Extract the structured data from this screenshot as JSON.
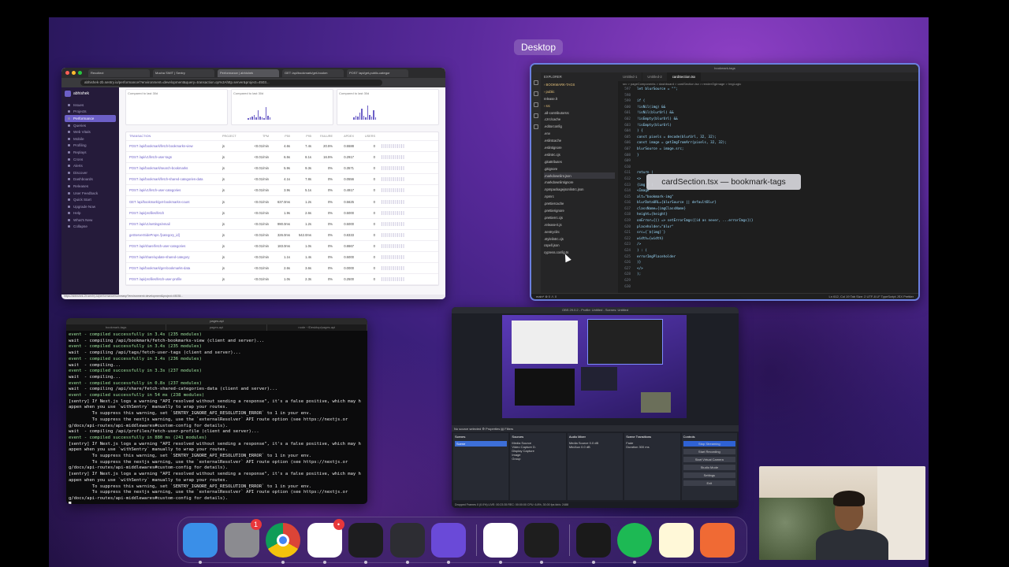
{
  "mission_control": {
    "space_label": "Desktop",
    "add_space": "+"
  },
  "browser": {
    "tabs": [
      "Recollect",
      "Mocha SWIT | Sentry",
      "Performance | abhishek",
      "GET /api/bookmark/get-bookm",
      "POST /api/get-public-categor"
    ],
    "url": "abhishek-2b.sentry.io/performance/?environment=development&query=transaction.op%3Ahttp.server&project=4503...",
    "org": "abhishek",
    "nav": [
      "Issues",
      "Projects",
      "Performance",
      "Queries",
      "Web Vitals",
      "Mobile",
      "Profiling",
      "Replays",
      "Crons",
      "Alerts",
      "Discover",
      "Dashboards",
      "Releases",
      "User Feedback",
      "Quick Start",
      "Upgrade Now",
      "Help",
      "What's New",
      "Collapse"
    ],
    "cards": [
      "Compared to last 30d",
      "Compared to last 30d",
      "Compared to last 30d"
    ],
    "table_header": [
      "TRANSACTION",
      "PROJECT",
      "TPM",
      "P50",
      "P95",
      "FAILURE",
      "APDEX",
      "USERS"
    ],
    "rows": [
      [
        "POST /api/bookmark/fetch-bookmarks-view",
        "js",
        "<0.01/min",
        "4.6s",
        "7.4s",
        "20.5%",
        "0.5588",
        "0"
      ],
      [
        "POST /api/v1/fetch-user-tags",
        "js",
        "<0.01/min",
        "6.5s",
        "8.1s",
        "16.5%",
        "0.2917",
        "0"
      ],
      [
        "POST /api/bookmark/search-bookmarks",
        "js",
        "<0.01/min",
        "5.9s",
        "9.3s",
        "0%",
        "0.3571",
        "0"
      ],
      [
        "POST /api/bookmark/fetch-shared-categories-data",
        "js",
        "<0.01/min",
        "4.1s",
        "7.8s",
        "0%",
        "0.0556",
        "0"
      ],
      [
        "POST /api/v1/fetch-user-categories",
        "js",
        "<0.01/min",
        "3.9s",
        "5.1s",
        "0%",
        "0.4917",
        "0"
      ],
      [
        "GET /api/bookmark/get-bookmarks-count",
        "js",
        "<0.01/min",
        "637.0ms",
        "1.2s",
        "0%",
        "0.5625",
        "0"
      ],
      [
        "POST /api/profiles/fetch",
        "js",
        "<0.01/min",
        "1.9s",
        "2.6s",
        "0%",
        "0.5000",
        "0"
      ],
      [
        "POST /api/v1/settings/email",
        "js",
        "<0.01/min",
        "990.0ms",
        "1.2s",
        "0%",
        "0.5000",
        "0"
      ],
      [
        "getServerSideProps /[category_id]",
        "js",
        "<0.01/min",
        "326.0ms",
        "542.0ms",
        "0%",
        "0.8333",
        "0"
      ],
      [
        "POST /api/share/fetch-user-categories",
        "js",
        "<0.01/min",
        "183.0ms",
        "1.0s",
        "0%",
        "0.8667",
        "0"
      ],
      [
        "POST /api/share/update-shared-category",
        "js",
        "<0.01/min",
        "1.1s",
        "1.4s",
        "0%",
        "0.5000",
        "0"
      ],
      [
        "POST /api/bookmark/get-bookmarks-data",
        "js",
        "<0.01/min",
        "2.6s",
        "3.6s",
        "0%",
        "0.0000",
        "0"
      ],
      [
        "POST /api/profiles/fetch-user-profile",
        "js",
        "<0.01/min",
        "1.0s",
        "2.3s",
        "0%",
        "0.2500",
        "0"
      ]
    ],
    "status": "https://abhishek-2b.sentry.io/performance/summary/?environment=development&project=45035..."
  },
  "vscode": {
    "title": "bookmark-tags",
    "explorer_header": "EXPLORER",
    "files": [
      {
        "name": "BOOKMARK-TAGS",
        "type": "folder"
      },
      {
        "name": "public",
        "type": "folder"
      },
      {
        "name": "release.lt",
        "type": "file"
      },
      {
        "name": "src",
        "type": "folder"
      },
      {
        "name": ".all-contributorsrc",
        "type": "file"
      },
      {
        "name": ".czrc/cache",
        "type": "file"
      },
      {
        "name": ".editorconfig",
        "type": "file"
      },
      {
        "name": ".env",
        "type": "file"
      },
      {
        "name": ".eslintcache",
        "type": "file"
      },
      {
        "name": ".eslintignore",
        "type": "file"
      },
      {
        "name": ".eslintrc.cjs",
        "type": "file"
      },
      {
        "name": ".gitattributes",
        "type": "file"
      },
      {
        "name": ".gitignore",
        "type": "file"
      },
      {
        "name": ".markdownlint.json",
        "type": "file"
      },
      {
        "name": ".markdownlintignore",
        "type": "file"
      },
      {
        "name": ".npmpackagejsonlintrc.json",
        "type": "file"
      },
      {
        "name": ".npmrc",
        "type": "file"
      },
      {
        "name": ".prettiercache",
        "type": "file"
      },
      {
        "name": ".prettierignore",
        "type": "file"
      },
      {
        "name": ".prettierrc.cjs",
        "type": "file"
      },
      {
        "name": ".release-it.js",
        "type": "file"
      },
      {
        "name": ".sentryclirc",
        "type": "file"
      },
      {
        "name": ".stylelintrc.cjs",
        "type": "file"
      },
      {
        "name": "cspell.json",
        "type": "file"
      },
      {
        "name": "cypress.config.ts",
        "type": "file"
      }
    ],
    "tabs": [
      "Untitled-1",
      "Untitled-2",
      "cardSection.tsx"
    ],
    "breadcrumb": "src > pageComponents > dashboard > cardSection.tsx > renderOgImage > ImgLogic",
    "line_numbers": [
      "597",
      "598",
      "599",
      "600",
      "601",
      "602",
      "603",
      "604",
      "605",
      "606",
      "607",
      "608",
      "609",
      "610",
      "611",
      "612",
      "613",
      "614",
      "615",
      "616",
      "617",
      "618",
      "619",
      "620",
      "621",
      "622",
      "623",
      "624",
      "625",
      "626",
      "627",
      "628",
      "629",
      "630"
    ],
    "code": [
      "let blurSource = \"\";",
      "",
      "if (",
      "  !isNil(img) &&",
      "  !isNil(blurUrl) &&",
      "  !isEmpty(blurUrl) &&",
      "  !isEmpty(blurUrl)",
      ") {",
      "  const pixels = decode(blurUrl, 32, 32);",
      "  const image = getImgFromArr(pixels, 32, 32);",
      "  blurSource = image.src;",
      "}",
      "",
      "",
      "return (",
      "  <>",
      "    {img ? (",
      "      <Image",
      "        alt=\"bookmark-img\"",
      "        blurDataURL={blurSource || defaultBlur}",
      "        className={imgClassName}",
      "        height={height}",
      "        onError={() => setErrorImgs([id as never, ...errorImgs])}",
      "        placeholder=\"blur\"",
      "        src={`${img}`}",
      "        width={width}",
      "      />",
      "    ) : (",
      "      errorImgPlaceholder",
      "    )}",
      "  </>",
      ");",
      "",
      ""
    ],
    "status_left": "main*  ⊗ 0 ⚠ 0",
    "status_right": "Ln 612, Col 19   Tab Size: 2   UTF-8   LF   TypeScript JSX   Prettier",
    "tooltip": "cardSection.tsx — bookmark-tags"
  },
  "terminal": {
    "title": "pages-api",
    "tabs": [
      "bookmark-tags",
      "pages-api",
      "node ~/Desktop/pages-api"
    ],
    "lines": [
      "event - compiled successfully in 3.4s (235 modules)",
      "wait  - compiling /api/bookmark/fetch-bookmarks-view (client and server)...",
      "event - compiled successfully in 3.4s (235 modules)",
      "wait  - compiling /api/tags/fetch-user-tags (client and server)...",
      "event - compiled successfully in 3.4s (236 modules)",
      "wait  - compiling...",
      "event - compiled successfully in 3.3s (237 modules)",
      "wait  - compiling...",
      "event - compiled successfully in 0.8s (237 modules)",
      "wait  - compiling /api/share/fetch-shared-categories-data (client and server)...",
      "event - compiled successfully in 54 ms (238 modules)",
      "[sentry] If Next.js logs a warning \"API resolved without sending a response\", it's a false positive, which may h",
      "appen when you use `withSentry` manually to wrap your routes.",
      "         To suppress this warning, set `SENTRY_IGNORE_API_RESOLUTION_ERROR` to 1 in your env.",
      "         To suppress the nextjs warning, use the `externalResolver` API route option (see https://nextjs.or",
      "g/docs/api-routes/api-middlewares#custom-config for details).",
      "wait  - compiling /api/profiles/fetch-user-profile (client and server)...",
      "event - compiled successfully in 880 ms (241 modules)",
      "[sentry] If Next.js logs a warning \"API resolved without sending a response\", it's a false positive, which may h",
      "appen when you use `withSentry` manually to wrap your routes.",
      "         To suppress this warning, set `SENTRY_IGNORE_API_RESOLUTION_ERROR` to 1 in your env.",
      "         To suppress the nextjs warning, use the `externalResolver` API route option (see https://nextjs.or",
      "g/docs/api-routes/api-middlewares#custom-config for details).",
      "[sentry] If Next.js logs a warning \"API resolved without sending a response\", it's a false positive, which may h",
      "appen when you use `withSentry` manually to wrap your routes.",
      "         To suppress this warning, set `SENTRY_IGNORE_API_RESOLUTION_ERROR` to 1 in your env.",
      "         To suppress the nextjs warning, use the `externalResolver` API route option (see https://nextjs.or",
      "g/docs/api-routes/api-middlewares#custom-config for details).",
      "█"
    ]
  },
  "obs": {
    "title": "OBS 29.0.2 - Profile: Untitled - Scenes: Untitled",
    "source_bar": "No source selected   ⚙ Properties   ▤ Filters",
    "panels": {
      "scenes": {
        "title": "Scenes",
        "items": [
          "Scene"
        ]
      },
      "sources": {
        "title": "Sources",
        "items": [
          "Media Source",
          "Video Capture D.",
          "Display Capture",
          "Image",
          "Group"
        ]
      },
      "mixer": {
        "title": "Audio Mixer",
        "items": [
          "Media Source  0.0 dB",
          "Mic/Aux  0.0 dB"
        ]
      },
      "transitions": {
        "title": "Scene Transitions",
        "items": [
          "Fade",
          "Duration  300 ms"
        ]
      },
      "controls": {
        "title": "Controls",
        "items": [
          "Stop Streaming",
          "Start Recording",
          "Start Virtual Camera",
          "Studio Mode",
          "Settings",
          "Exit"
        ]
      }
    },
    "status": "Dropped Frames 0 (0.0%)   LIVE: 00:23:35   REC: 00:00:00   CPU: 6.8%, 30.00 fps   kb/s: 2488"
  },
  "dock": {
    "items": [
      {
        "name": "finder",
        "color": "#3a8fe8",
        "badge": null
      },
      {
        "name": "system-settings",
        "color": "#8b8b90",
        "badge": "1"
      },
      {
        "name": "chrome",
        "color": "#ffffff",
        "badge": null
      },
      {
        "name": "slack",
        "color": "#ffffff",
        "badge": "•"
      },
      {
        "name": "terminal",
        "color": "#1d1d1f",
        "badge": null
      },
      {
        "name": "obs",
        "color": "#2d2d33",
        "badge": null
      },
      {
        "name": "imovie-star",
        "color": "#6a4ad8",
        "badge": null
      },
      {
        "name": "vscode",
        "color": "#ffffff",
        "badge": null
      },
      {
        "name": "figma",
        "color": "#1e1e1e",
        "badge": null
      },
      {
        "name": "iterm",
        "color": "#1a1a1a",
        "badge": null
      },
      {
        "name": "spotify",
        "color": "#1db954",
        "badge": null
      },
      {
        "name": "notes",
        "color": "#fff8d8",
        "badge": null
      },
      {
        "name": "pencil-app",
        "color": "#f06a34",
        "badge": null
      }
    ]
  }
}
